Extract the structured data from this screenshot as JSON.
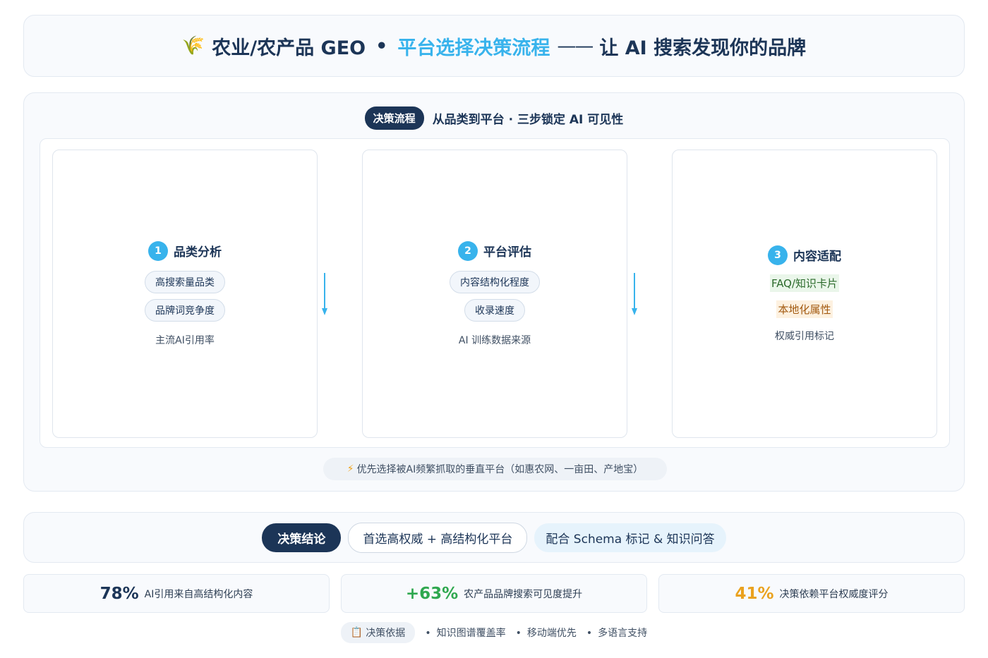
{
  "header": {
    "icon": "wheat-icon",
    "part1": "农业/农产品 GEO",
    "separator": "•",
    "part2": "平台选择决策流程",
    "dash": "——",
    "part3": "让 AI 搜索发现你的品牌"
  },
  "flow": {
    "badge": "决策流程",
    "subtitle": "从品类到平台 · 三步锁定 AI 可见性",
    "steps": [
      {
        "num": "1",
        "title": "品类分析",
        "tags": [
          "高搜索量品类",
          "品牌词竞争度"
        ],
        "plain": "主流AI引用率"
      },
      {
        "num": "2",
        "title": "平台评估",
        "tags": [
          "内容结构化程度",
          "收录速度"
        ],
        "plain": "AI 训练数据来源"
      },
      {
        "num": "3",
        "title": "内容适配",
        "tag_green": "FAQ/知识卡片",
        "tag_orange": "本地化属性",
        "plain": "权威引用标记"
      }
    ],
    "note": "优先选择被AI频繁抓取的垂直平台（如惠农网、一亩田、产地宝）",
    "note_icon": "lightning-icon"
  },
  "conclusion": {
    "badge": "决策结论",
    "primary": "首选高权威 + 高结构化平台",
    "secondary": "配合 Schema 标记 & 知识问答"
  },
  "stats": [
    {
      "value": "78%",
      "label": "AI引用来自高结构化内容",
      "color": "#1c3557"
    },
    {
      "value": "+63%",
      "label": "农产品品牌搜索可见度提升",
      "color": "#2fa84f"
    },
    {
      "value": "41%",
      "label": "决策依赖平台权威度评分",
      "color": "#eaa21f"
    }
  ],
  "footer": {
    "pill_icon": "clipboard-icon",
    "pill": "决策依据",
    "items": [
      "知识图谱覆盖率",
      "移动端优先",
      "多语言支持"
    ]
  },
  "colors": {
    "accent": "#38b3ec",
    "dark": "#1c3557"
  }
}
